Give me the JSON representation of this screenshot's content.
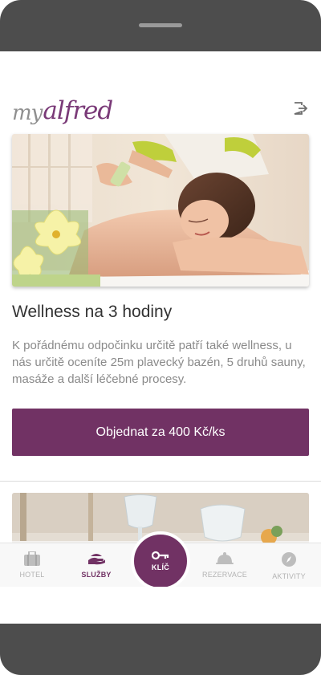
{
  "app": {
    "logo_my": "my",
    "logo_alfred": "alfred",
    "accent_color": "#713264"
  },
  "header": {
    "logout_icon": "logout-icon"
  },
  "card": {
    "title": "Wellness na 3 hodiny",
    "description": "K pořádnému odpočinku určitě patří také wellness, u nás určitě oceníte 25m plavecký bazén, 5 druhů sauny, masáže a další léčebné procesy.",
    "button_label": "Objednat za 400 Kč/ks",
    "image": "massage-photo"
  },
  "next_card": {
    "image": "restaurant-table-photo"
  },
  "bottom_nav": {
    "items": [
      {
        "label": "HOTEL",
        "icon": "suitcase-icon"
      },
      {
        "label": "SLUŽBY",
        "icon": "serving-hand-icon"
      },
      {
        "label": "REZERVACE",
        "icon": "cloche-icon"
      },
      {
        "label": "AKTIVITY",
        "icon": "compass-icon"
      }
    ],
    "center": {
      "label": "KLÍČ",
      "icon": "key-icon"
    },
    "active": "SLUŽBY"
  },
  "system_nav": {
    "icons": [
      "back-icon",
      "home-icon",
      "recents-icon"
    ]
  }
}
